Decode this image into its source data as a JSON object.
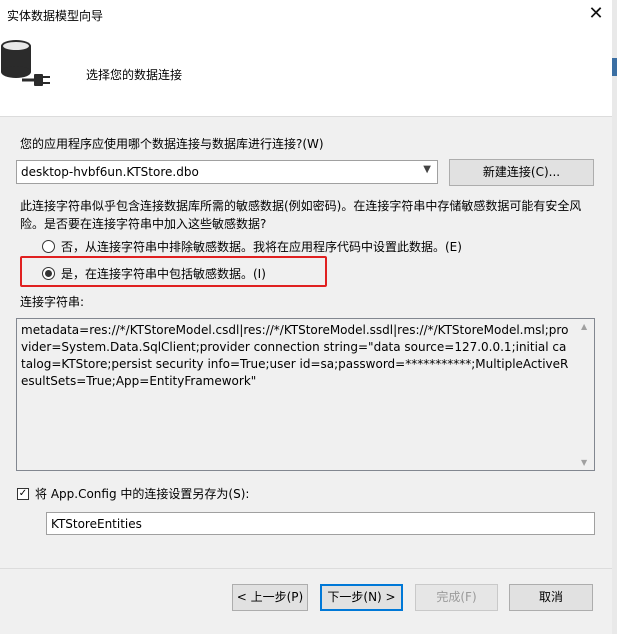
{
  "window": {
    "title": "实体数据模型向导",
    "close_glyph": "✕"
  },
  "header": {
    "title": "选择您的数据连接",
    "icon": "database-connection-icon"
  },
  "question": {
    "label": "您的应用程序应使用哪个数据连接与数据库进行连接?(W)"
  },
  "connection_select": {
    "value": "desktop-hvbf6un.KTStore.dbo"
  },
  "buttons": {
    "new_connection": "新建连接(C)...",
    "previous": "< 上一步(P)",
    "next": "下一步(N) >",
    "finish": "完成(F)",
    "cancel": "取消"
  },
  "sensitive": {
    "warning": "此连接字符串似乎包含连接数据库所需的敏感数据(例如密码)。在连接字符串中存储敏感数据可能有安全风险。是否要在连接字符串中加入这些敏感数据?",
    "option_exclude": "否，从连接字符串中排除敏感数据。我将在应用程序代码中设置此数据。(E)",
    "option_include": "是，在连接字符串中包括敏感数据。(I)",
    "selected": "include"
  },
  "connection_string": {
    "label": "连接字符串:",
    "value": "metadata=res://*/KTStoreModel.csdl|res://*/KTStoreModel.ssdl|res://*/KTStoreModel.msl;provider=System.Data.SqlClient;provider connection string=\"data source=127.0.0.1;initial catalog=KTStore;persist security info=True;user id=sa;password=***********;MultipleActiveResultSets=True;App=EntityFramework\""
  },
  "save_config": {
    "checked": true,
    "label": "将 App.Config 中的连接设置另存为(S):",
    "entity_name": "KTStoreEntities"
  },
  "colors": {
    "accent": "#0078d7",
    "highlight_box": "#e02020",
    "body_bg": "#f0f0f0"
  }
}
